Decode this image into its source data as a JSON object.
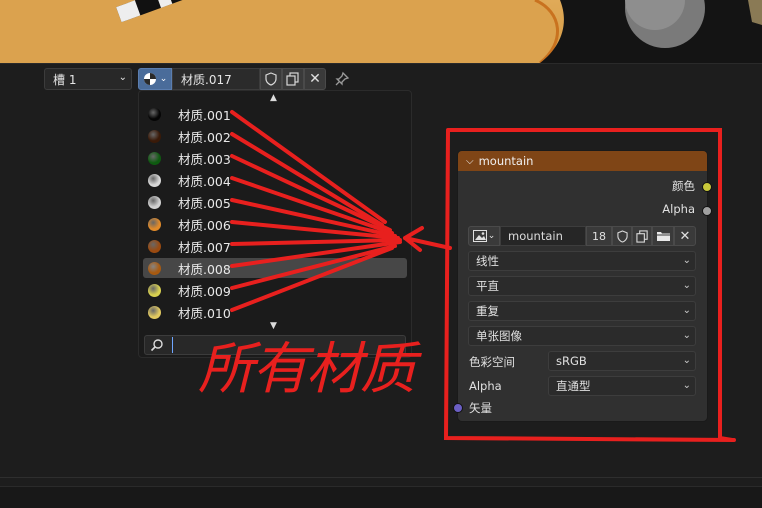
{
  "header": {
    "slot_label": "槽 1",
    "material_name": "材质.017"
  },
  "material_list": {
    "items": [
      {
        "name": "材质.001",
        "color": "#050505"
      },
      {
        "name": "材质.002",
        "color": "#3a1a08"
      },
      {
        "name": "材质.003",
        "color": "#0e5a10"
      },
      {
        "name": "材质.004",
        "color": "#d8d8d8"
      },
      {
        "name": "材质.005",
        "color": "#d0d0d0"
      },
      {
        "name": "材质.006",
        "color": "#e08a2a"
      },
      {
        "name": "材质.007",
        "color": "#9a4a10"
      },
      {
        "name": "材质.008",
        "color": "#a85a10"
      },
      {
        "name": "材质.009",
        "color": "#d8d050"
      },
      {
        "name": "材质.010",
        "color": "#e0c860"
      }
    ],
    "active_index": 7,
    "search_value": ""
  },
  "annotation": {
    "text": "所有材质",
    "color": "#e8201e"
  },
  "node": {
    "title": "mountain",
    "outputs": {
      "color_label": "颜色",
      "alpha_label": "Alpha"
    },
    "image": {
      "name": "mountain",
      "users": "18"
    },
    "interpolation": "线性",
    "projection": "平直",
    "extension": "重复",
    "source": "单张图像",
    "color_space_label": "色彩空间",
    "color_space_value": "sRGB",
    "alpha_label": "Alpha",
    "alpha_value": "直通型",
    "input_label": "矢量",
    "header_color": "#7f4516"
  }
}
